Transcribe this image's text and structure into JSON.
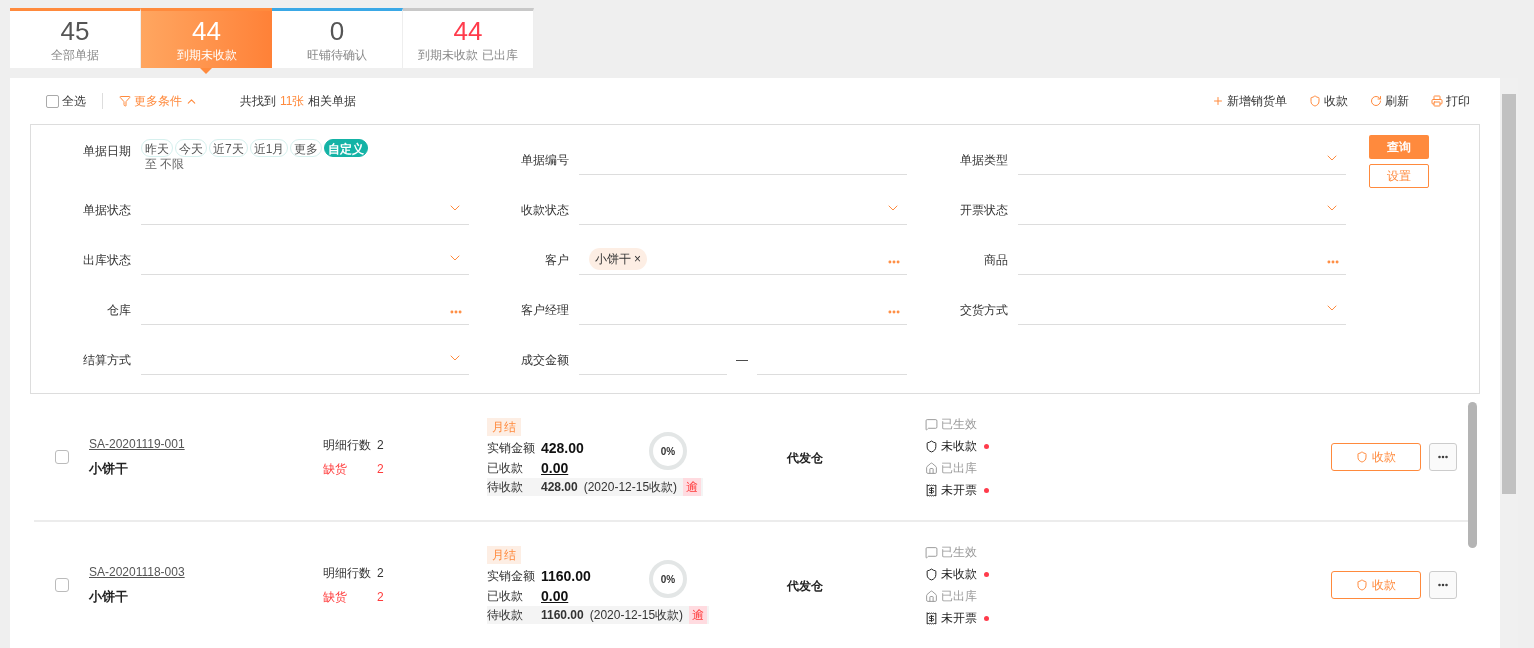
{
  "summary_tabs": [
    {
      "count": "45",
      "label": "全部单据",
      "selected": false,
      "color": "#ff8a3d",
      "alert": false
    },
    {
      "count": "44",
      "label": "到期未收款",
      "selected": true,
      "color": "#ff8a3d",
      "alert": false
    },
    {
      "count": "0",
      "label": "旺铺待确认",
      "selected": false,
      "color": "#3aa8e6",
      "alert": false
    },
    {
      "count": "44",
      "label": "到期未收款 已出库",
      "selected": false,
      "color": "#c8c8c8",
      "alert": true
    }
  ],
  "toolbar": {
    "select_all": {
      "label": "全选",
      "checked": false
    },
    "more_filters": {
      "label": "更多条件",
      "expanded": true
    },
    "result_prefix": "共找到",
    "result_count": "11张",
    "result_suffix": "相关单据",
    "actions": [
      {
        "kind": "add",
        "label": "新增销货单"
      },
      {
        "kind": "collect",
        "label": "收款"
      },
      {
        "kind": "refresh",
        "label": "刷新"
      },
      {
        "kind": "print",
        "label": "打印"
      }
    ]
  },
  "filters": [
    {
      "kind": "date",
      "label": "单据日期",
      "chips": [
        {
          "label": "昨天",
          "selected": false
        },
        {
          "label": "今天",
          "selected": false
        },
        {
          "label": "近7天",
          "selected": false
        },
        {
          "label": "近1月",
          "selected": false
        },
        {
          "label": "更多",
          "selected": false
        },
        {
          "label": "自定义",
          "selected": true
        }
      ],
      "range_text": "至 不限"
    },
    {
      "kind": "text",
      "label": "单据编号"
    },
    {
      "kind": "select",
      "label": "单据类型"
    },
    {
      "kind": "select",
      "label": "单据状态"
    },
    {
      "kind": "select",
      "label": "收款状态"
    },
    {
      "kind": "select",
      "label": "开票状态"
    },
    {
      "kind": "select",
      "label": "出库状态"
    },
    {
      "kind": "picker",
      "label": "客户",
      "tags": [
        {
          "label": "小饼干",
          "remove": "×"
        }
      ]
    },
    {
      "kind": "picker",
      "label": "商品"
    },
    {
      "kind": "picker",
      "label": "仓库"
    },
    {
      "kind": "picker",
      "label": "客户经理"
    },
    {
      "kind": "select",
      "label": "交货方式"
    },
    {
      "kind": "select",
      "label": "结算方式"
    },
    {
      "kind": "range",
      "label": "成交金额",
      "separator": "—"
    }
  ],
  "filter_buttons": {
    "query": "查询",
    "settings": "设置"
  },
  "orders": [
    {
      "checked": false,
      "code": "SA-20201119-001",
      "customer": "小饼干",
      "detail_label": "明细行数",
      "detail_count": "2",
      "shortage_label": "缺货",
      "shortage_count": "2",
      "term": "月结",
      "amount_label": "实销金额",
      "amount": "428.00",
      "paid_label": "已收款",
      "paid": "0.00",
      "due_label": "待收款",
      "due": "428.00",
      "due_date": "(2020-12-15收款)",
      "overdue": "逾",
      "level": 0,
      "progress": "0%",
      "warehouse": "代发仓",
      "statuses": [
        {
          "kind": "effective",
          "label": "已生效",
          "done": true
        },
        {
          "kind": "payment",
          "label": "未收款",
          "done": false
        },
        {
          "kind": "outbound",
          "label": "已出库",
          "done": true
        },
        {
          "kind": "invoice",
          "label": "未开票",
          "done": false
        }
      ],
      "action": "收款"
    },
    {
      "checked": false,
      "code": "SA-20201118-003",
      "customer": "小饼干",
      "detail_label": "明细行数",
      "detail_count": "2",
      "shortage_label": "缺货",
      "shortage_count": "2",
      "term": "月结",
      "amount_label": "实销金额",
      "amount": "1160.00",
      "paid_label": "已收款",
      "paid": "0.00",
      "due_label": "待收款",
      "due": "1160.00",
      "due_date": "(2020-12-15收款)",
      "overdue": "逾",
      "level": 0,
      "progress": "0%",
      "warehouse": "代发仓",
      "statuses": [
        {
          "kind": "effective",
          "label": "已生效",
          "done": true
        },
        {
          "kind": "payment",
          "label": "未收款",
          "done": false
        },
        {
          "kind": "outbound",
          "label": "已出库",
          "done": true
        },
        {
          "kind": "invoice",
          "label": "未开票",
          "done": false
        }
      ],
      "action": "收款"
    }
  ]
}
